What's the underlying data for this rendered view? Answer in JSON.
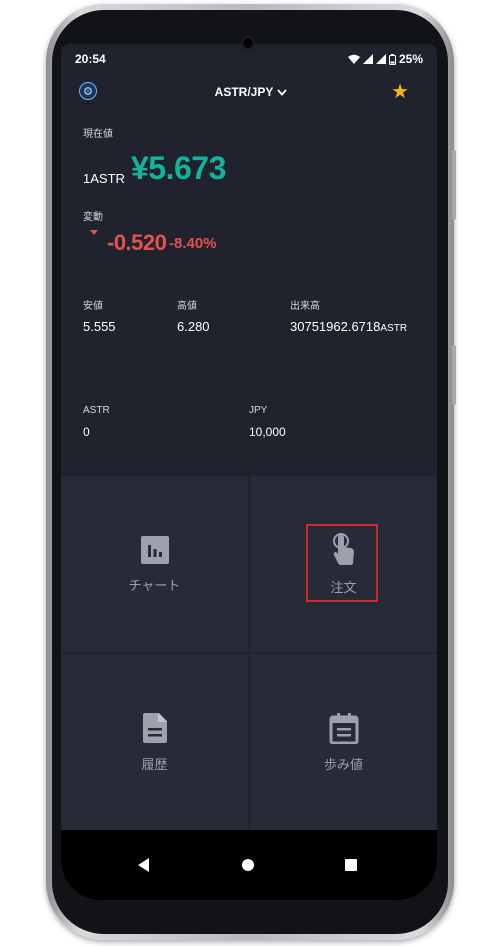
{
  "status_bar": {
    "time": "20:54",
    "battery": "25%"
  },
  "header": {
    "pair": "ASTR/JPY",
    "favorite_icon": "star-icon",
    "dropdown_icon": "chevron-down-icon"
  },
  "price": {
    "label": "現在値",
    "unit": "1ASTR",
    "value": "¥5.673"
  },
  "change": {
    "label": "変動",
    "value": "-0.520",
    "percent": "-8.40%"
  },
  "stats": {
    "low_label": "安値",
    "low_value": "5.555",
    "high_label": "高値",
    "high_value": "6.280",
    "volume_label": "出来高",
    "volume_value": "30751962.6718",
    "volume_unit": "ASTR"
  },
  "balances": {
    "astr_label": "ASTR",
    "astr_value": "0",
    "jpy_label": "JPY",
    "jpy_value": "10,000"
  },
  "menu": {
    "chart": {
      "label": "チャート",
      "icon": "bar-chart-icon"
    },
    "order": {
      "label": "注文",
      "icon": "touch-hand-icon"
    },
    "history": {
      "label": "履歴",
      "icon": "document-icon"
    },
    "ticks": {
      "label": "歩み値",
      "icon": "calendar-icon"
    }
  },
  "colors": {
    "background": "#20232e",
    "tile": "#272a37",
    "price_up_teal": "#10b49b",
    "change_red": "#e2524f",
    "star": "#f3b619",
    "highlight": "#d7262b"
  }
}
